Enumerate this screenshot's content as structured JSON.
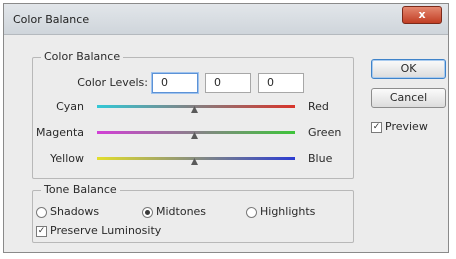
{
  "window": {
    "title": "Color Balance",
    "close_glyph": "x"
  },
  "color_balance": {
    "legend": "Color Balance",
    "levels_label": "Color Levels:",
    "levels": [
      "0",
      "0",
      "0"
    ],
    "sliders": [
      {
        "left": "Cyan",
        "right": "Red",
        "value": 0,
        "gradient": [
          "#32c8d6",
          "#d8342a"
        ]
      },
      {
        "left": "Magenta",
        "right": "Green",
        "value": 0,
        "gradient": [
          "#d23fd6",
          "#3ec43a"
        ]
      },
      {
        "left": "Yellow",
        "right": "Blue",
        "value": 0,
        "gradient": [
          "#e2de2c",
          "#2c3cd2"
        ]
      }
    ]
  },
  "tone_balance": {
    "legend": "Tone Balance",
    "options": [
      "Shadows",
      "Midtones",
      "Highlights"
    ],
    "selected": "Midtones",
    "preserve_label": "Preserve Luminosity",
    "preserve_checked": true
  },
  "buttons": {
    "ok": "OK",
    "cancel": "Cancel"
  },
  "preview": {
    "label": "Preview",
    "checked": true
  }
}
